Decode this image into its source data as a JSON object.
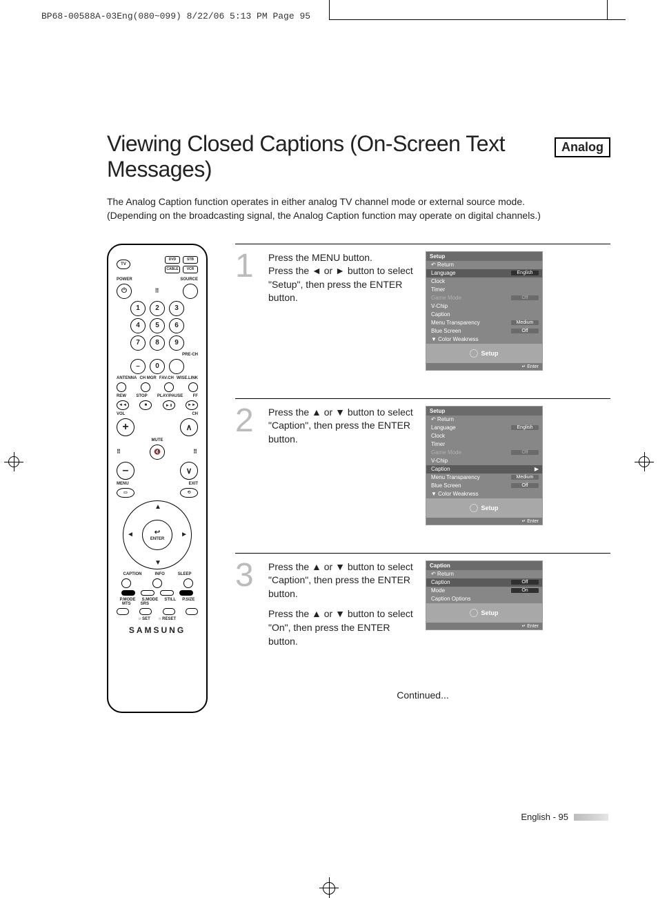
{
  "header_line": "BP68-00588A-03Eng(080~099)  8/22/06  5:13 PM  Page 95",
  "title": "Viewing Closed Captions (On-Screen Text Messages)",
  "badge": "Analog",
  "intro": "The Analog Caption function operates in either analog TV channel mode or external source mode. (Depending on the broadcasting signal, the Analog Caption function may operate on digital channels.)",
  "remote": {
    "top": {
      "tv": "TV",
      "dvd": "DVD",
      "stb": "STB",
      "cable": "CABLE",
      "vcr": "VCR"
    },
    "power": "POWER",
    "source": "SOURCE",
    "nums": [
      "1",
      "2",
      "3",
      "4",
      "5",
      "6",
      "7",
      "8",
      "9",
      "0"
    ],
    "dash": "–",
    "prech": "PRE-CH",
    "row_a": [
      "ANTENNA",
      "CH MGR",
      "FAV.CH",
      "WISE.LINK"
    ],
    "transport_lbl": [
      "REW",
      "STOP",
      "PLAY/PAUSE",
      "FF"
    ],
    "transport": [
      "◄◄",
      "■",
      "►॥",
      "►►"
    ],
    "vol": "VOL",
    "ch": "CH",
    "mute": "MUTE",
    "menu": "MENU",
    "exit": "EXIT",
    "enter": "ENTER",
    "caption": "CAPTION",
    "info": "INFO",
    "sleep": "SLEEP",
    "row_p": [
      "P.MODE",
      "S.MODE",
      "STILL",
      "P.SIZE"
    ],
    "row_m": [
      "MTS",
      "SRS"
    ],
    "row_s": [
      "○ SET",
      "○ RESET"
    ],
    "brand": "SAMSUNG"
  },
  "steps": [
    {
      "num": "1",
      "text": "Press the MENU button.\nPress the ◄ or ► button to select \"Setup\", then press the ENTER button.",
      "osd": {
        "title": "Setup",
        "items": [
          {
            "label": "Return",
            "type": "return"
          },
          {
            "label": "Language",
            "value": "English",
            "hl": true
          },
          {
            "label": "Clock"
          },
          {
            "label": "Timer"
          },
          {
            "label": "Game Mode",
            "value": "Off",
            "dim": true
          },
          {
            "label": "V-Chip"
          },
          {
            "label": "Caption"
          },
          {
            "label": "Menu Transparency",
            "value": "Medium"
          },
          {
            "label": "Blue Screen",
            "value": "Off"
          },
          {
            "label": "▼ Color Weakness",
            "type": "more"
          }
        ],
        "foot": "Setup",
        "enter": "Enter"
      }
    },
    {
      "num": "2",
      "text": "Press the ▲ or ▼ button to select \"Caption\", then press the ENTER button.",
      "osd": {
        "title": "Setup",
        "items": [
          {
            "label": "Return",
            "type": "return"
          },
          {
            "label": "Language",
            "value": "English"
          },
          {
            "label": "Clock"
          },
          {
            "label": "Timer"
          },
          {
            "label": "Game Mode",
            "value": "Off",
            "dim": true
          },
          {
            "label": "V-Chip"
          },
          {
            "label": "Caption",
            "hl": true,
            "arrow": true
          },
          {
            "label": "Menu Transparency",
            "value": "Medium"
          },
          {
            "label": "Blue Screen",
            "value": "Off"
          },
          {
            "label": "▼ Color Weakness",
            "type": "more"
          }
        ],
        "foot": "Setup",
        "enter": "Enter"
      }
    },
    {
      "num": "3",
      "text": "Press the ▲ or ▼ button to select \"Caption\", then press the ENTER button.",
      "text2": "Press the ▲ or ▼ button to select \"On\", then press the ENTER button.",
      "osd": {
        "title": "Caption",
        "items": [
          {
            "label": "Return",
            "type": "return"
          },
          {
            "label": "Caption",
            "value": "Off",
            "hl": true
          },
          {
            "label": "Mode",
            "value": "On",
            "hlval": true
          },
          {
            "label": "Caption Options"
          }
        ],
        "foot": "Setup",
        "enter": "Enter"
      }
    }
  ],
  "continued": "Continued...",
  "footer": "English - 95"
}
